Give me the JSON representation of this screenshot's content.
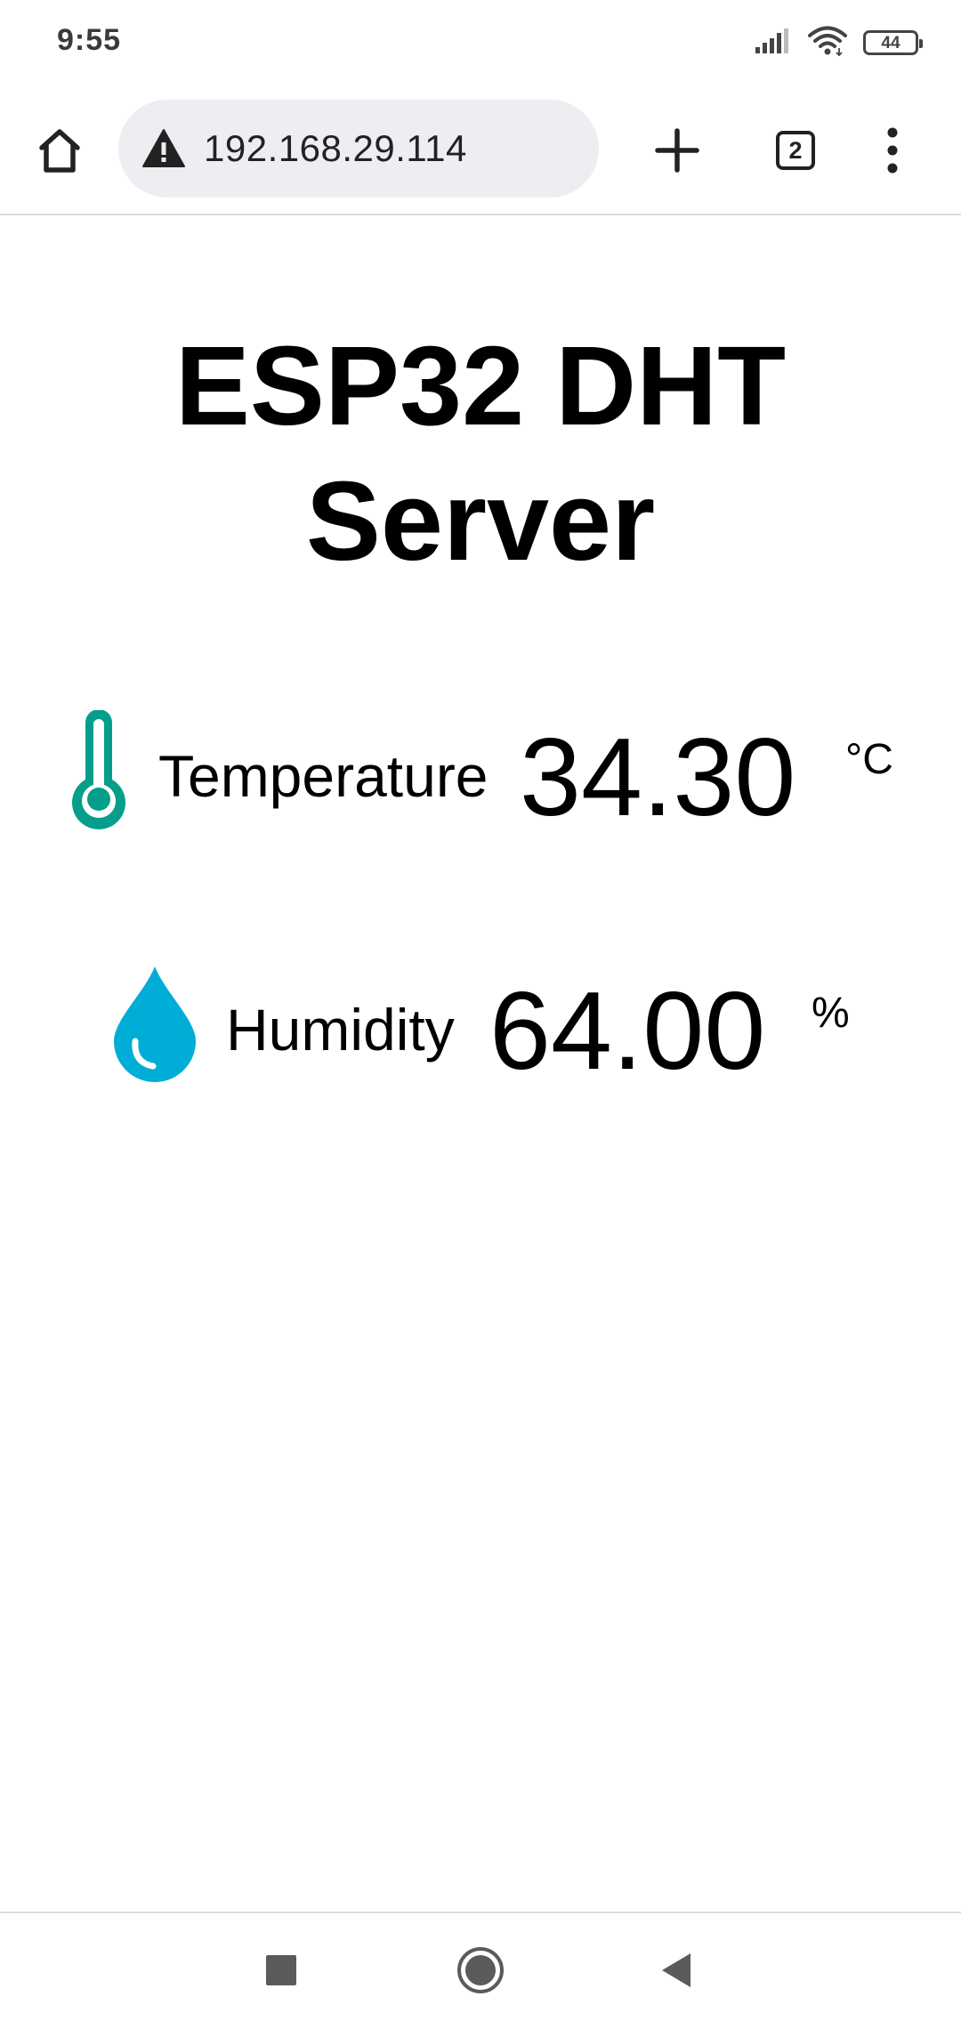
{
  "status_bar": {
    "time": "9:55",
    "battery_level": "44",
    "icons": [
      "signal-icon",
      "wifi-icon",
      "battery-icon"
    ]
  },
  "browser": {
    "url": "192.168.29.114",
    "tab_count": "2",
    "icons": [
      "home-icon",
      "not-secure-warning-icon",
      "new-tab-icon",
      "tab-switcher-icon",
      "overflow-menu-icon"
    ]
  },
  "page": {
    "title": "ESP32 DHT Server",
    "readings": [
      {
        "label": "Temperature",
        "value": "34.30",
        "unit": "°C",
        "icon": "thermometer-icon",
        "color": "#059e8a"
      },
      {
        "label": "Humidity",
        "value": "64.00",
        "unit": "%",
        "icon": "water-drop-icon",
        "color": "#00add6"
      }
    ]
  },
  "nav_bar": {
    "buttons": [
      "recents-button",
      "home-button",
      "back-button"
    ]
  }
}
